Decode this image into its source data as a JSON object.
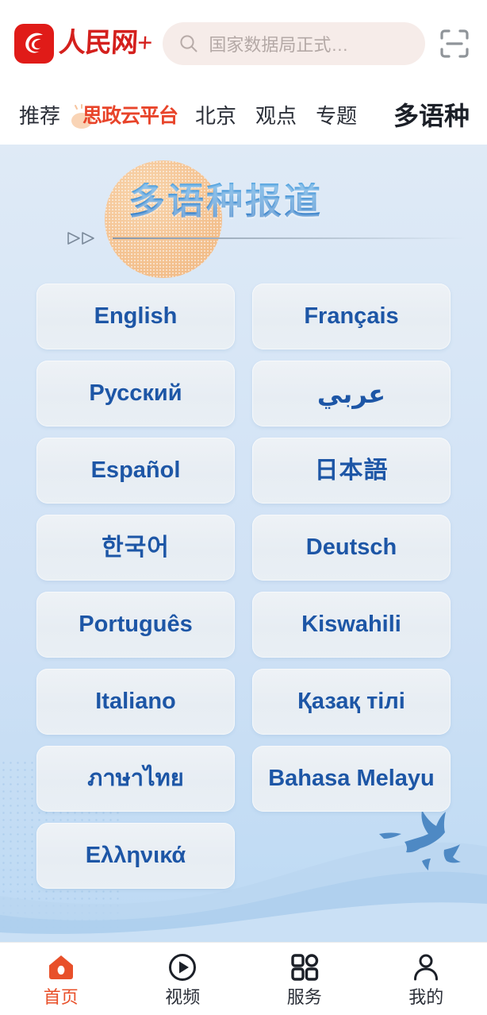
{
  "header": {
    "brand_logo_icon": "people-daily-logo-icon",
    "brand_text": "人民网+",
    "search": {
      "icon": "search-icon",
      "placeholder": "国家数据局正式…",
      "value": ""
    },
    "scan_icon": "scan-code-icon"
  },
  "nav_tabs": [
    {
      "label": "推荐",
      "active": false,
      "style": "normal"
    },
    {
      "label": "思政云平台",
      "active": false,
      "style": "promo"
    },
    {
      "label": "北京",
      "active": false,
      "style": "normal"
    },
    {
      "label": "观点",
      "active": false,
      "style": "normal"
    },
    {
      "label": "专题",
      "active": false,
      "style": "normal"
    },
    {
      "label": "多语种",
      "active": true,
      "style": "normal"
    }
  ],
  "banner": {
    "title": "多语种报道",
    "arrows_icon": "double-triangle-right-icon",
    "circle_icon": "sun-circle-decoration"
  },
  "languages": [
    {
      "label": "English",
      "script": "latin"
    },
    {
      "label": "Français",
      "script": "latin"
    },
    {
      "label": "Русский",
      "script": "cyrillic"
    },
    {
      "label": "عربي",
      "script": "arabic"
    },
    {
      "label": "Español",
      "script": "latin"
    },
    {
      "label": "日本語",
      "script": "cjk"
    },
    {
      "label": "한국어",
      "script": "cjk"
    },
    {
      "label": "Deutsch",
      "script": "latin"
    },
    {
      "label": "Português",
      "script": "latin"
    },
    {
      "label": "Kiswahili",
      "script": "latin"
    },
    {
      "label": "Italiano",
      "script": "latin"
    },
    {
      "label": "Қазақ тілі",
      "script": "cyrillic"
    },
    {
      "label": "ภาษาไทย",
      "script": "thai"
    },
    {
      "label": "Bahasa Melayu",
      "script": "latin"
    },
    {
      "label": "Ελληνικά",
      "script": "greek"
    }
  ],
  "decorations": {
    "birds_icon": "flying-doves-icon",
    "hill_icon": "wave-hill-decoration",
    "dot_pattern_icon": "dot-grid-texture"
  },
  "bottom_nav": [
    {
      "label": "首页",
      "icon": "home-icon",
      "active": true
    },
    {
      "label": "视频",
      "icon": "play-circle-icon",
      "active": false
    },
    {
      "label": "服务",
      "icon": "grid-apps-icon",
      "active": false
    },
    {
      "label": "我的",
      "icon": "user-person-icon",
      "active": false
    }
  ],
  "colors": {
    "brand_red": "#d4201d",
    "accent_orange": "#e8502a",
    "promo_red": "#e8442a",
    "card_blue_text": "#1d56a6",
    "banner_blue": "#2573c3",
    "page_bg_top": "#dfeaf6",
    "page_bg_bottom": "#bcd9f3"
  }
}
